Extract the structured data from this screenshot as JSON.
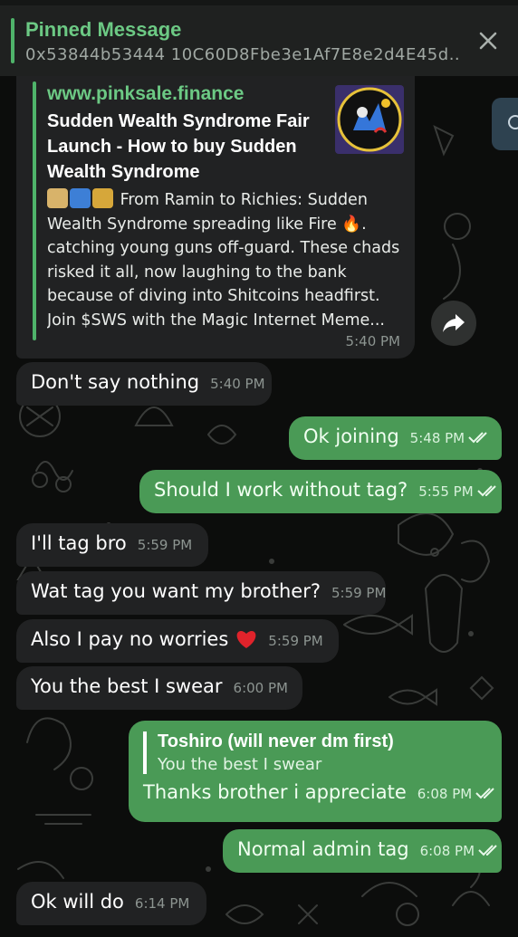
{
  "pinned": {
    "title": "Pinned Message",
    "subtitle": "0x53844b53444 10C60D8Fbe3e1Af7E8e2d4E45d..."
  },
  "preview": {
    "site": "www.pinksale.finance",
    "headline": "Sudden Wealth Syndrome Fair Launch - How to buy Sudden Wealth Syndrome",
    "body_lines": [
      "From Ramin to Richies: Sudden",
      "Wealth Syndrome spreading like Fire 🔥.",
      "catching young guns off-guard. These chads",
      "risked it all, now laughing to the bank",
      "because of diving into Shitcoins headfirst.",
      "Join $SWS with the Magic Internet Meme..."
    ],
    "time": "5:40 PM"
  },
  "messages": [
    {
      "text": "Don't say nothing",
      "time": "5:40 PM"
    },
    {
      "text": "Ok joining",
      "time": "5:48 PM"
    },
    {
      "text": "Should I work without tag?",
      "time": "5:55 PM"
    },
    {
      "text": "I'll tag bro",
      "time": "5:59 PM"
    },
    {
      "text": "Wat tag you want my brother?",
      "time": "5:59 PM"
    },
    {
      "text": "Also I pay no worries",
      "time": "5:59 PM"
    },
    {
      "text": "You the best I swear",
      "time": "6:00 PM"
    },
    {
      "text": "Thanks brother i appreciate",
      "time": "6:08 PM",
      "reply": {
        "name": "Toshiro (will never dm first)",
        "text": "You the best I swear"
      }
    },
    {
      "text": "Normal admin tag",
      "time": "6:08 PM"
    },
    {
      "text": "Ok will do",
      "time": "6:14 PM"
    }
  ],
  "icons": {
    "close": "close-icon",
    "share": "share-arrow-icon",
    "search": "search-icon",
    "read": "double-check-icon",
    "heart": "red-heart-emoji"
  },
  "colors": {
    "accent": "#4fb36a",
    "outgoing": "#4a9a56",
    "incoming": "#212223"
  }
}
